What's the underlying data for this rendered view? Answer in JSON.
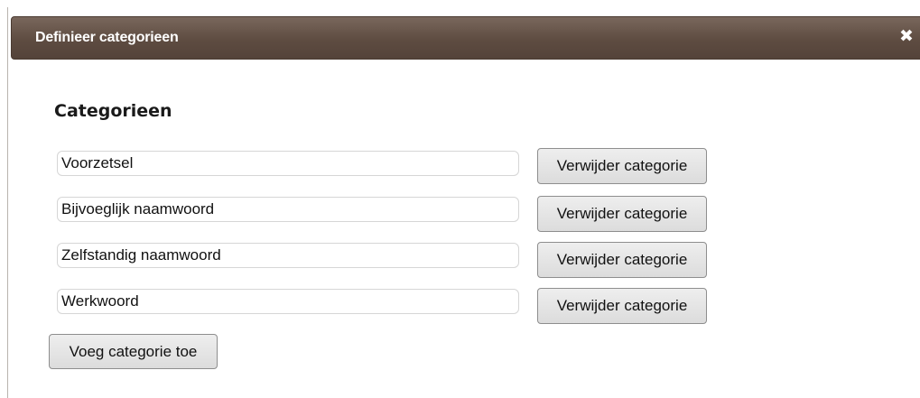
{
  "dialog": {
    "title": "Definieer categorieen",
    "close_icon": "close-icon",
    "close_glyph": "✖"
  },
  "section": {
    "heading": "Categorieen"
  },
  "categories": [
    {
      "value": "Voorzetsel",
      "delete_label": "Verwijder categorie"
    },
    {
      "value": "Bijvoeglijk naamwoord",
      "delete_label": "Verwijder categorie"
    },
    {
      "value": "Zelfstandig naamwoord",
      "delete_label": "Verwijder categorie"
    },
    {
      "value": "Werkwoord",
      "delete_label": "Verwijder categorie"
    }
  ],
  "add_button_label": "Voeg categorie toe",
  "colors": {
    "titlebar": "#5e4c41",
    "title_text": "#ffffff",
    "button_bg": "#e4e4e4"
  }
}
